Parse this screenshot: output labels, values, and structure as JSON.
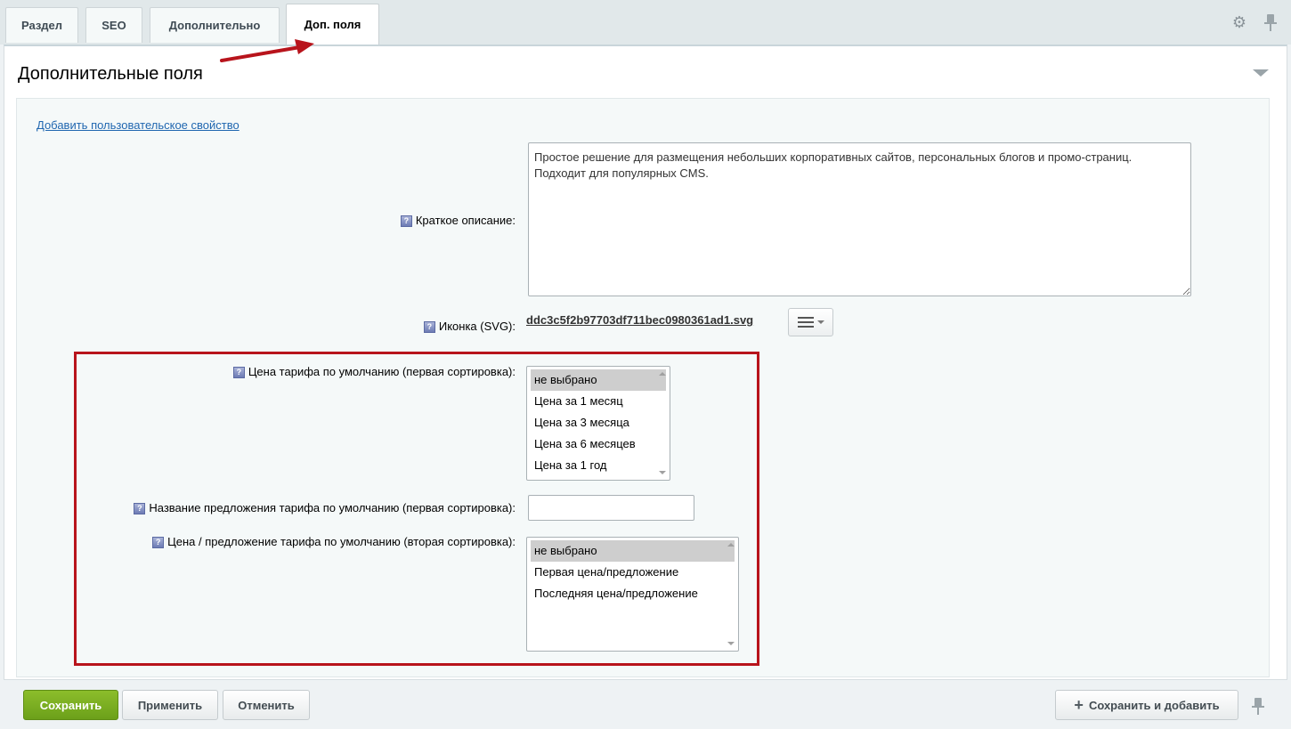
{
  "tabs": [
    {
      "label": "Раздел"
    },
    {
      "label": "SEO"
    },
    {
      "label": "Дополнительно"
    },
    {
      "label": "Доп. поля",
      "active": true
    }
  ],
  "panel": {
    "title": "Дополнительные поля",
    "add_property_link": "Добавить пользовательское свойство"
  },
  "fields": {
    "short_description": {
      "label": "Краткое описание:",
      "value": "Простое решение для размещения небольших корпоративных сайтов, персональных блогов и промо-страниц. Подходит для популярных CMS."
    },
    "icon_svg": {
      "label": "Иконка (SVG):",
      "file_name": "ddc3c5f2b97703df711bec0980361ad1.svg"
    },
    "default_price_first": {
      "label": "Цена тарифа по умолчанию (первая сортировка):",
      "options": [
        "не выбрано",
        "Цена за 1 месяц",
        "Цена за 3 месяца",
        "Цена за 6 месяцев",
        "Цена за 1 год"
      ],
      "selected": "не выбрано"
    },
    "default_offer_name_first": {
      "label": "Название предложения тарифа по умолчанию (первая сортировка):",
      "value": ""
    },
    "default_price_offer_second": {
      "label": "Цена / предложение тарифа по умолчанию (вторая сортировка):",
      "options": [
        "не выбрано",
        "Первая цена/предложение",
        "Последняя цена/предложение"
      ],
      "selected": "не выбрано"
    }
  },
  "footer": {
    "save": "Сохранить",
    "apply": "Применить",
    "cancel": "Отменить",
    "save_and_add": "Сохранить и добавить"
  },
  "icons": {
    "settings": "gear-icon",
    "pin": "pin-icon",
    "collapse": "chevron-down-icon",
    "help": "help-icon",
    "menu": "hamburger-menu-icon",
    "plus": "plus-icon"
  },
  "colors": {
    "save_button": "#7aaf20",
    "highlight": "#b8141c",
    "link": "#2067b0"
  }
}
